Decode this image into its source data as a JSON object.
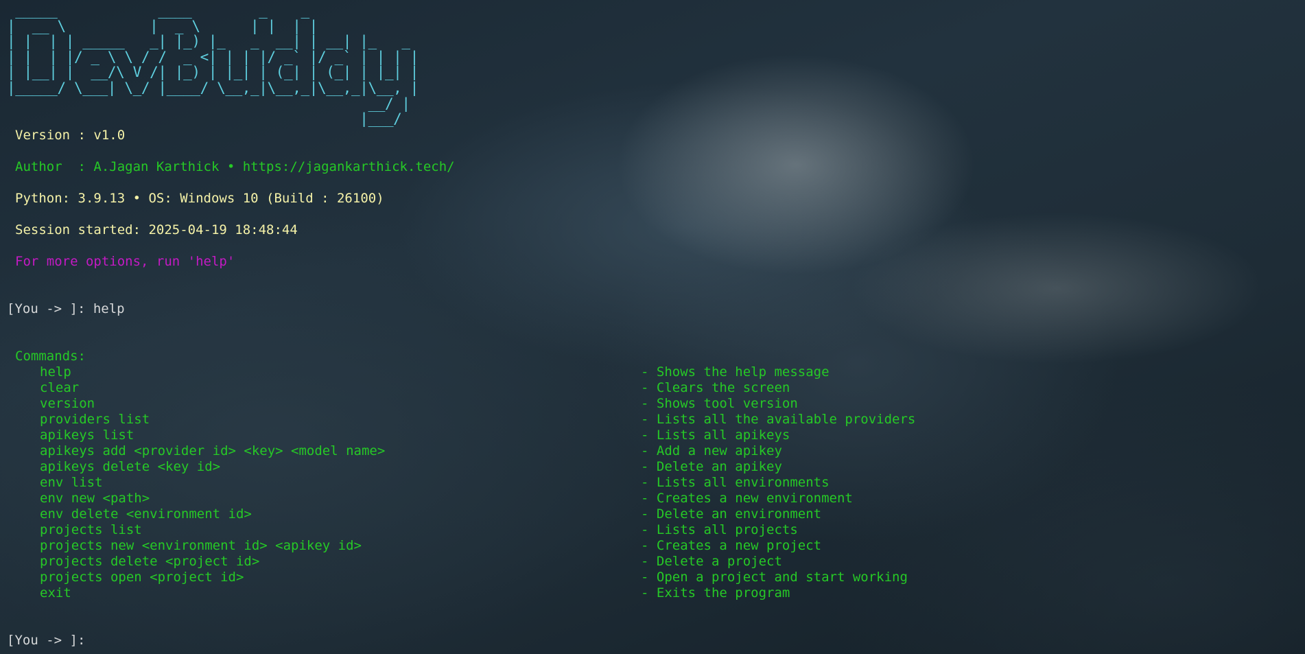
{
  "banner_art": " _____            ____        _    _\n|  __ \\          |  _ \\      | |  | |\n| |  | | _____   _| |_) |_   _  __| | __| |_   _\n| |  | |/ _ \\ \\ / /  _ <| | | |/ _` |/ _` | | | |\n| |__| |  __/\\ V /| |_) | |_| | (_| | (_| | |_| |\n|_____/ \\___| \\_/ |____/ \\__,_|\\__,_|\\__,_|\\__, |\n                                           __/ |\n                                          |___/",
  "info": {
    "version": "Version : v1.0",
    "author": "Author  : A.Jagan Karthick • https://jagankarthick.tech/",
    "python": "Python: 3.9.13 • OS: Windows 10 (Build : 26100)",
    "session": "Session started: 2025-04-19 18:48:44",
    "hint": "For more options, run 'help'"
  },
  "prompt1": "[You -> ]: help",
  "commands_header": "Commands:",
  "commands": [
    {
      "name": "help",
      "desc": "- Shows the help message"
    },
    {
      "name": "clear",
      "desc": "- Clears the screen"
    },
    {
      "name": "version",
      "desc": "- Shows tool version"
    },
    {
      "name": "providers list",
      "desc": "- Lists all the available providers"
    },
    {
      "name": "apikeys list",
      "desc": "- Lists all apikeys"
    },
    {
      "name": "apikeys add <provider id> <key> <model name>",
      "desc": "- Add a new apikey"
    },
    {
      "name": "apikeys delete <key id>",
      "desc": "- Delete an apikey"
    },
    {
      "name": "env list",
      "desc": "- Lists all environments"
    },
    {
      "name": "env new <path>",
      "desc": "- Creates a new environment"
    },
    {
      "name": "env delete <environment id>",
      "desc": "- Delete an environment"
    },
    {
      "name": "projects list",
      "desc": "- Lists all projects"
    },
    {
      "name": "projects new <environment id> <apikey id>",
      "desc": "- Creates a new project"
    },
    {
      "name": "projects delete <project id>",
      "desc": "- Delete a project"
    },
    {
      "name": "projects open <project id>",
      "desc": "- Open a project and start working"
    },
    {
      "name": "exit",
      "desc": "- Exits the program"
    }
  ],
  "prompt2": "[You -> ]:",
  "colors": {
    "banner": "#5fd0e0",
    "info_yellow": "#f5f2a8",
    "info_green": "#26c926",
    "hint_magenta": "#c41ac4",
    "prompt": "#d6d8d9"
  }
}
